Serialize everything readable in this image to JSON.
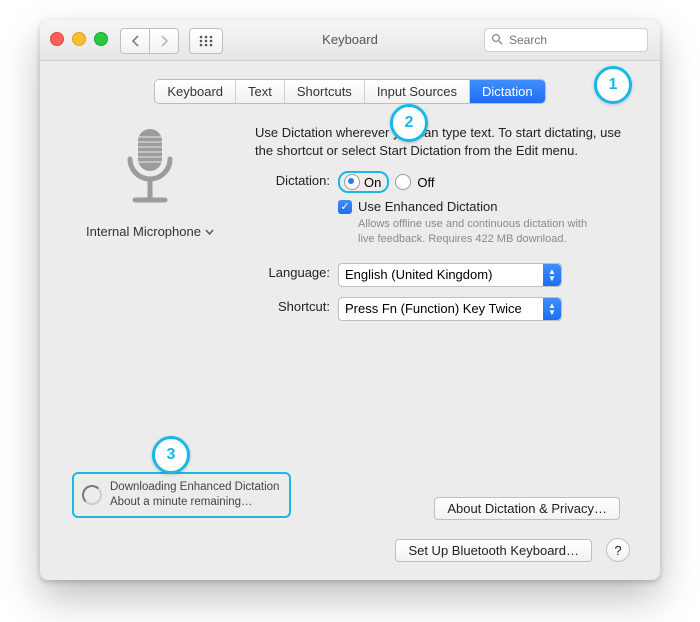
{
  "header": {
    "title": "Keyboard",
    "search_placeholder": "Search"
  },
  "tabs": [
    "Keyboard",
    "Text",
    "Shortcuts",
    "Input Sources",
    "Dictation"
  ],
  "active_tab": "Dictation",
  "mic": {
    "label": "Internal Microphone"
  },
  "intro": "Use Dictation wherever you can type text. To start dictating, use the shortcut or select Start Dictation from the Edit menu.",
  "dictation": {
    "label": "Dictation:",
    "on_label": "On",
    "off_label": "Off",
    "value": "On",
    "enhanced_checked": true,
    "enhanced_label": "Use Enhanced Dictation",
    "enhanced_hint": "Allows offline use and continuous dictation with live feedback. Requires 422 MB download."
  },
  "language": {
    "label": "Language:",
    "value": "English (United Kingdom)"
  },
  "shortcut": {
    "label": "Shortcut:",
    "value": "Press Fn (Function) Key Twice"
  },
  "download": {
    "line1": "Downloading Enhanced Dictation",
    "line2": "About a minute remaining…"
  },
  "buttons": {
    "about": "About Dictation & Privacy…",
    "bluetooth": "Set Up Bluetooth Keyboard…",
    "help": "?"
  },
  "callouts": {
    "c1": "1",
    "c2": "2",
    "c3": "3"
  }
}
